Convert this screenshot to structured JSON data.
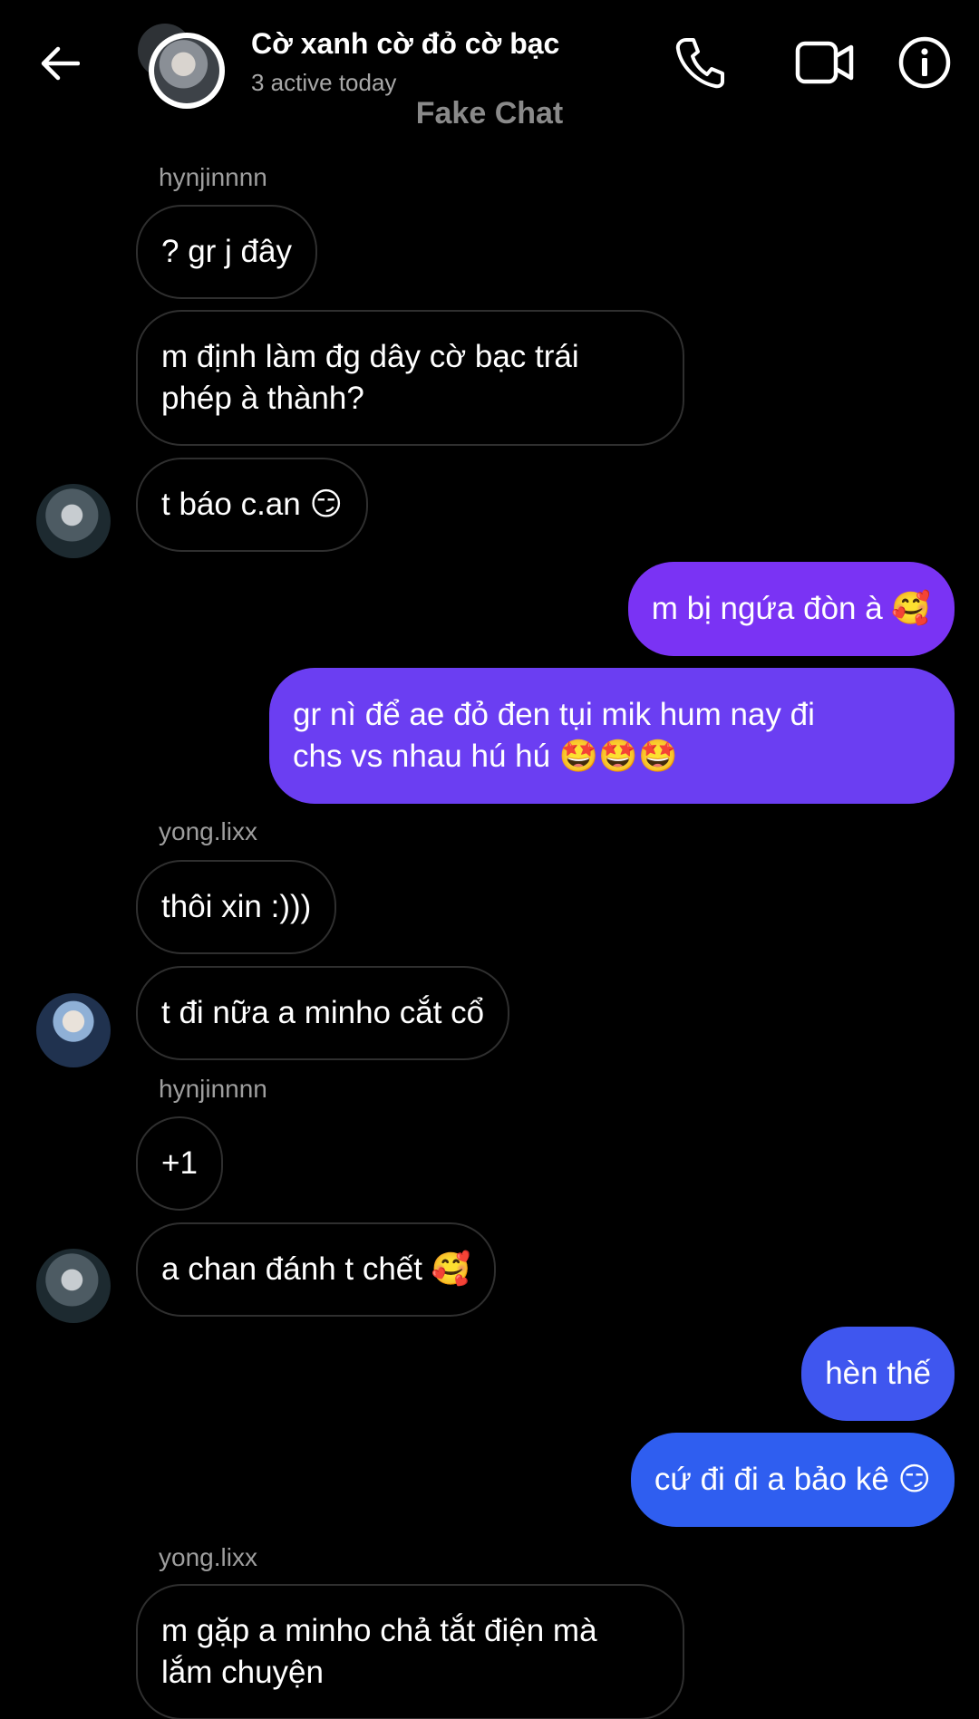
{
  "header": {
    "title": "Cờ xanh cờ đỏ cờ bạc",
    "subtitle": "3 active today",
    "watermark": "Fake Chat",
    "icons": {
      "back": "arrow-left-icon",
      "call": "phone-icon",
      "video": "video-camera-icon",
      "info": "info-icon"
    }
  },
  "colors": {
    "background": "#000000",
    "incoming_border": "#2f2f2f",
    "outgoing_top": "#7b2ff7",
    "outgoing_bottom": "#2f5ef0",
    "sender_name": "#9e9e9e"
  },
  "messages": [
    {
      "sender": "hynjinnnn"
    },
    {
      "text": "? gr j đây"
    },
    {
      "text": "m định làm đg dây cờ bạc trái\nphép à thành?"
    },
    {
      "text": "t báo c.an 😏"
    },
    {
      "text": "m bị ngứa đòn à 🥰"
    },
    {
      "text": "gr nì để ae đỏ đen tụi mik hum nay đi\nchs vs nhau hú hú 🤩🤩🤩"
    },
    {
      "sender": "yong.lixx"
    },
    {
      "text": "thôi xin :)))"
    },
    {
      "text": "t đi nữa a minho cắt cổ"
    },
    {
      "sender": "hynjinnnn"
    },
    {
      "text": "+1"
    },
    {
      "text": "a chan đánh t chết 🥰"
    },
    {
      "text": "hèn thế"
    },
    {
      "text": "cứ đi đi a bảo kê 😏"
    },
    {
      "sender": "yong.lixx"
    },
    {
      "text": "m gặp a minho chả tắt điện mà\nlắm chuyện"
    }
  ]
}
